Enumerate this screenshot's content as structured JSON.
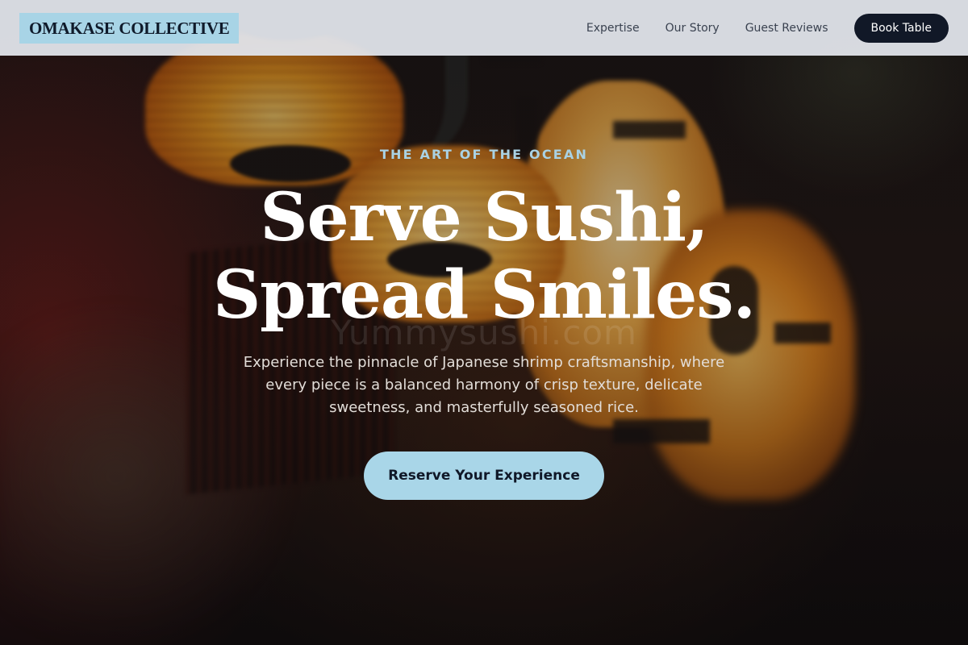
{
  "header": {
    "logo": "OMAKASE COLLECTIVE",
    "nav": [
      {
        "label": "Expertise"
      },
      {
        "label": "Our Story"
      },
      {
        "label": "Guest Reviews"
      }
    ],
    "book_label": "Book Table"
  },
  "hero": {
    "eyebrow": "THE ART OF THE OCEAN",
    "headline_line1": "Serve Sushi,",
    "headline_line2": "Spread Smiles.",
    "watermark": "Yummysushi.com",
    "subtext": "Experience the pinnacle of Japanese shrimp craftsmanship, where every piece is a balanced harmony of crisp texture, delicate sweetness, and masterfully seasoned rice.",
    "cta_label": "Reserve Your Experience"
  },
  "colors": {
    "accent": "#a9d6e8",
    "dark": "#111827",
    "header_bg": "#e2e6ec"
  }
}
